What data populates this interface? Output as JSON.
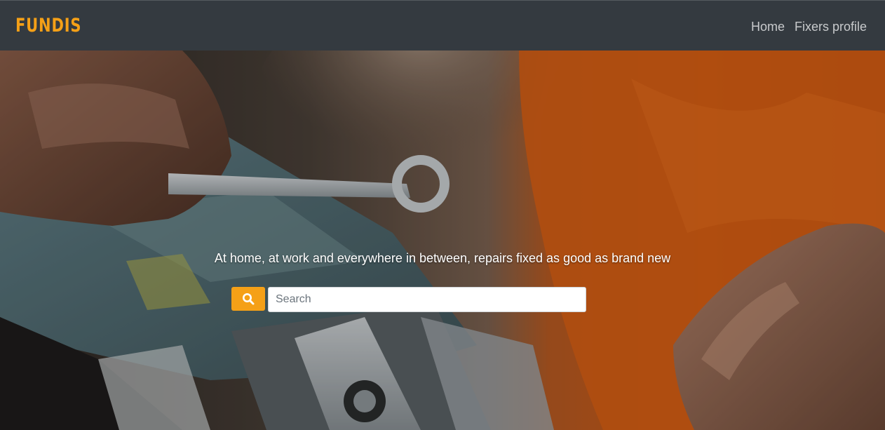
{
  "navbar": {
    "brand": "FUNDIS",
    "links": [
      {
        "label": "Home"
      },
      {
        "label": "Fixers profile"
      }
    ]
  },
  "hero": {
    "tagline": "At home, at work and everywhere in between, repairs fixed as good as brand new",
    "background_image": "photo-hands-holding-wrench-over-toolbox-orange-workwear",
    "search": {
      "placeholder": "Search",
      "value": "",
      "button_icon": "search-icon"
    }
  },
  "colors": {
    "navbar_bg": "#343a40",
    "brand": "#f5a017",
    "nav_link": "#c8cacc",
    "accent": "#f5a017"
  }
}
